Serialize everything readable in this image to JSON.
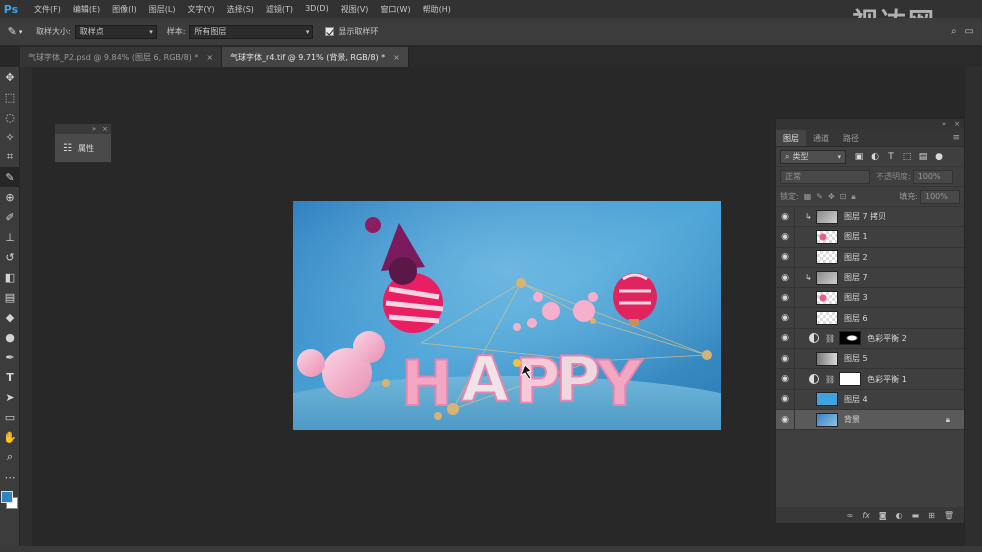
{
  "app": {
    "logo": "Ps"
  },
  "menu": [
    "文件(F)",
    "编辑(E)",
    "图像(I)",
    "图层(L)",
    "文字(Y)",
    "选择(S)",
    "滤镜(T)",
    "3D(D)",
    "视图(V)",
    "窗口(W)",
    "帮助(H)"
  ],
  "options": {
    "sample_size_label": "取样大小:",
    "sample_size_value": "取样点",
    "sample_label": "样本:",
    "sample_value": "所有图层",
    "show_ring_label": "显示取样环"
  },
  "tabs": [
    {
      "label": "气球字体_P2.psd @ 9.84% (图层 6, RGB/8) *",
      "active": false
    },
    {
      "label": "气球字体_r4.tif @ 9.71% (背景, RGB/8) *",
      "active": true
    }
  ],
  "properties_panel": {
    "title": "属性"
  },
  "layers_panel": {
    "tabs": [
      "图层",
      "通道",
      "路径"
    ],
    "filter_value": "类型",
    "blend_mode": "正常",
    "opacity_label": "不透明度:",
    "opacity_value": "100%",
    "lock_label": "锁定:",
    "fill_label": "填充:",
    "fill_value": "100%",
    "layers": [
      {
        "name": "图层 7 拷贝",
        "thumb": "gray",
        "clip": true,
        "selected": false
      },
      {
        "name": "图层 1",
        "thumb": "checker-pink",
        "clip": false,
        "selected": false
      },
      {
        "name": "图层 2",
        "thumb": "checker",
        "clip": false,
        "selected": false
      },
      {
        "name": "图层 7",
        "thumb": "gray",
        "clip": true,
        "selected": false
      },
      {
        "name": "图层 3",
        "thumb": "checker-pink",
        "clip": false,
        "selected": false
      },
      {
        "name": "图层 6",
        "thumb": "checker",
        "clip": false,
        "selected": false
      },
      {
        "name": "色彩平衡 2",
        "thumb": "black-mask",
        "adjustment": true,
        "selected": false
      },
      {
        "name": "图层 5",
        "thumb": "gradient",
        "clip": false,
        "selected": false
      },
      {
        "name": "色彩平衡 1",
        "thumb": "white-mask",
        "adjustment": true,
        "selected": false
      },
      {
        "name": "图层 4",
        "thumb": "blue",
        "clip": false,
        "selected": false
      },
      {
        "name": "背景",
        "thumb": "photo",
        "locked": true,
        "selected": true
      }
    ]
  },
  "canvas": {
    "letters": [
      "H",
      "A",
      "P",
      "P",
      "Y"
    ]
  },
  "watermark": {
    "text": "视达网"
  },
  "colors": {
    "accent": "#3fa3f0",
    "foreground": "#2e86c1",
    "background": "#ffffff"
  }
}
